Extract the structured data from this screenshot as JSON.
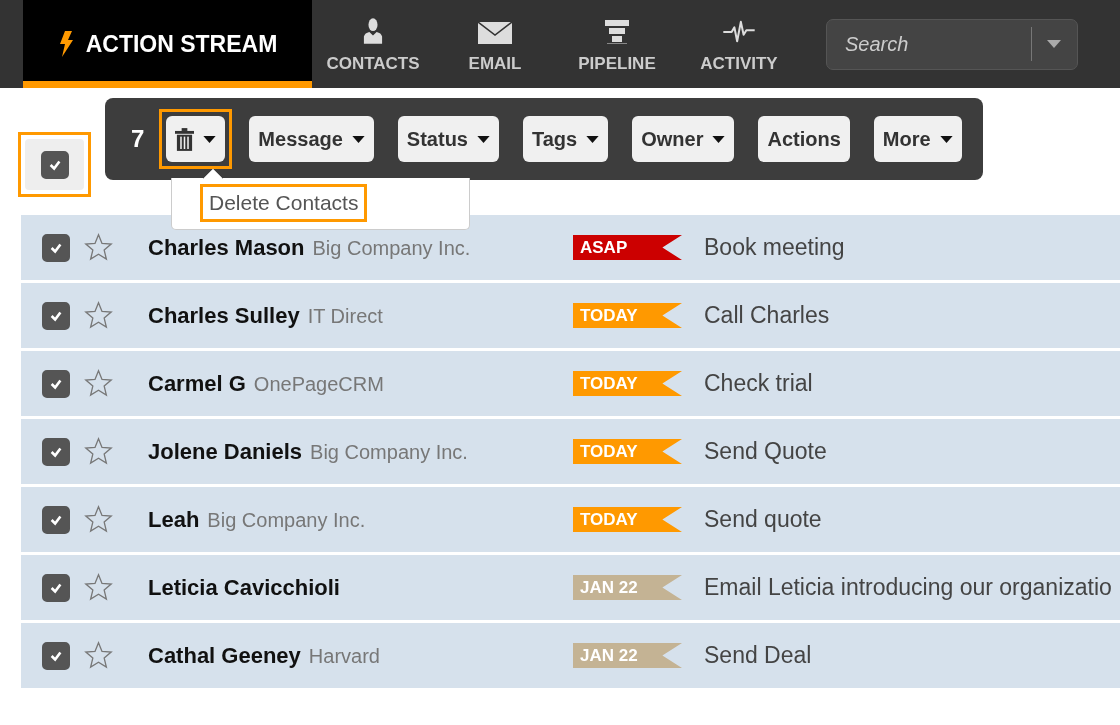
{
  "nav": {
    "tabs": [
      {
        "label": "ACTION STREAM",
        "kind": "stream",
        "selected": true
      },
      {
        "label": "CONTACTS",
        "kind": "contacts",
        "selected": false
      },
      {
        "label": "EMAIL",
        "kind": "email",
        "selected": false
      },
      {
        "label": "PIPELINE",
        "kind": "pipeline",
        "selected": false
      },
      {
        "label": "ACTIVITY",
        "kind": "activity",
        "selected": false
      }
    ],
    "search": {
      "placeholder": "Search"
    }
  },
  "select_all": {
    "checked": true,
    "highlighted": true
  },
  "toolbar": {
    "count": "7",
    "buttons": [
      {
        "kind": "trash",
        "dropdown": true,
        "highlighted": true
      },
      {
        "kind": "text",
        "label": "Message",
        "dropdown": true,
        "highlighted": false
      },
      {
        "kind": "text",
        "label": "Status",
        "dropdown": true,
        "highlighted": false
      },
      {
        "kind": "text",
        "label": "Tags",
        "dropdown": true,
        "highlighted": false
      },
      {
        "kind": "text",
        "label": "Owner",
        "dropdown": true,
        "highlighted": false
      },
      {
        "kind": "text",
        "label": "Actions",
        "dropdown": false,
        "highlighted": false
      },
      {
        "kind": "text",
        "label": "More",
        "dropdown": true,
        "highlighted": false
      }
    ]
  },
  "menu": {
    "items": [
      {
        "label": "Delete Contacts",
        "highlighted": true
      }
    ]
  },
  "rows": [
    {
      "checked": true,
      "starred": false,
      "name": "Charles Mason",
      "company": "Big Company Inc.",
      "tag": "ASAP",
      "color": "#cc0000",
      "task": "Book meeting"
    },
    {
      "checked": true,
      "starred": false,
      "name": "Charles Sulley",
      "company": "IT Direct",
      "tag": "TODAY",
      "color": "#ff9900",
      "task": "Call Charles"
    },
    {
      "checked": true,
      "starred": false,
      "name": "Carmel G",
      "company": "OnePageCRM",
      "tag": "TODAY",
      "color": "#ff9900",
      "task": "Check trial"
    },
    {
      "checked": true,
      "starred": false,
      "name": "Jolene Daniels",
      "company": "Big Company Inc.",
      "tag": "TODAY",
      "color": "#ff9900",
      "task": "Send Quote"
    },
    {
      "checked": true,
      "starred": false,
      "name": "Leah",
      "company": "Big Company Inc.",
      "tag": "TODAY",
      "color": "#ff9900",
      "task": "Send quote"
    },
    {
      "checked": true,
      "starred": false,
      "name": "Leticia Cavicchioli",
      "tag": "JAN 22",
      "color": "#c4b394",
      "task": "Email Leticia introducing our organizatio"
    },
    {
      "checked": true,
      "starred": false,
      "name": "Cathal Geeney",
      "company": "Harvard",
      "tag": "JAN 22",
      "color": "#c4b394",
      "task": "Send Deal"
    }
  ]
}
